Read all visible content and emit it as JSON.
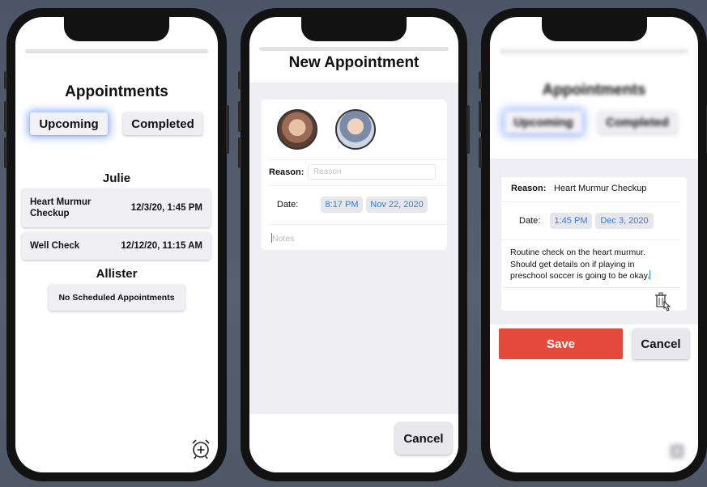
{
  "screen1": {
    "title": "Appointments",
    "segments": {
      "upcoming": "Upcoming",
      "completed": "Completed"
    },
    "groups": [
      {
        "name": "Julie",
        "appointments": [
          {
            "reason": "Heart Murmur Checkup",
            "datetime": "12/3/20, 1:45 PM"
          },
          {
            "reason": "Well Check",
            "datetime": "12/12/20, 11:15 AM"
          }
        ]
      },
      {
        "name": "Allister",
        "empty_label": "No Scheduled Appointments"
      }
    ],
    "add_icon": "alarm-add-icon"
  },
  "screen2": {
    "title": "New Appointment",
    "avatars": [
      "child-photo-1",
      "child-photo-2"
    ],
    "reason_label": "Reason:",
    "reason_placeholder": "Reason",
    "date_label": "Date:",
    "time_value": "8:17 PM",
    "date_value": "Nov 22, 2020",
    "notes_placeholder": "Notes",
    "cancel_label": "Cancel"
  },
  "screen3": {
    "background_title": "Appointments",
    "background_segments": {
      "upcoming": "Upcoming",
      "completed": "Completed"
    },
    "reason_label": "Reason:",
    "reason_value": "Heart Murmur Checkup",
    "date_label": "Date:",
    "time_value": "1:45 PM",
    "date_value": "Dec 3, 2020",
    "notes_value": "Routine check on the heart murmur. Should get details on if playing in preschool soccer is going to be okay.",
    "delete_icon": "trash-icon",
    "save_label": "Save",
    "cancel_label": "Cancel"
  },
  "colors": {
    "accent_blue": "#2f7de1",
    "save_red": "#e54b3c",
    "glow_blue": "#3c78ff"
  }
}
